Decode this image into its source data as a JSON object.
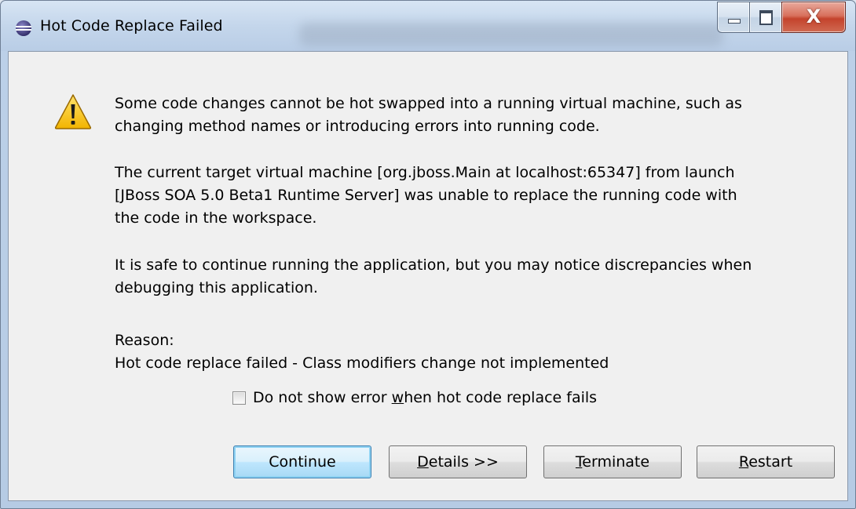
{
  "window": {
    "title": "Hot Code Replace Failed",
    "close_label": "X"
  },
  "message": {
    "p1": "Some code changes cannot be hot swapped into a running virtual machine, such as\nchanging method names or introducing errors into running code.",
    "p2": "The current target virtual machine [org.jboss.Main at localhost:65347] from launch\n[JBoss SOA 5.0 Beta1 Runtime Server] was unable to replace the running code with\nthe code in the workspace.",
    "p3": "It is safe to continue running the application, but you may notice discrepancies when\ndebugging this application.",
    "reason_label": "Reason:",
    "reason_text": "Hot code replace failed - Class modifiers change not implemented"
  },
  "checkbox": {
    "label_before": "Do not show error ",
    "label_mnemonic": "w",
    "label_after": "hen hot code replace fails",
    "checked": false
  },
  "buttons": {
    "continue": {
      "mnemonic": "",
      "rest": "Continue"
    },
    "details": {
      "mnemonic": "D",
      "rest": "etails >>"
    },
    "terminate": {
      "mnemonic": "T",
      "rest": "erminate"
    },
    "restart": {
      "mnemonic": "R",
      "rest": "estart"
    }
  },
  "icons": {
    "app": "eclipse-icon",
    "warning": "warning-icon"
  },
  "colors": {
    "titlebar": "#c4d6eb",
    "close_button": "#c4432c",
    "dialog_bg": "#f0f0f0",
    "default_button": "#bee6fd"
  }
}
